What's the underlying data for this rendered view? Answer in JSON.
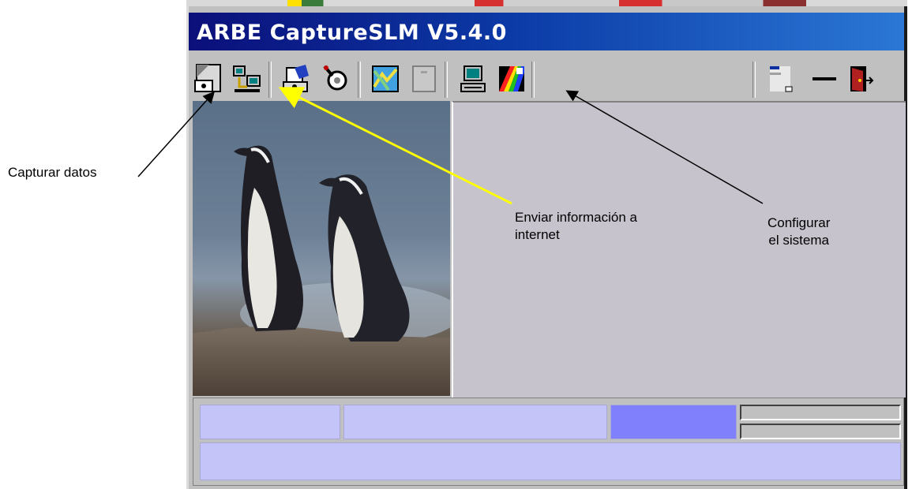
{
  "window": {
    "title": "ARBE CaptureSLM V5.4.0"
  },
  "toolbar": {
    "buttons": [
      {
        "name": "capture-data-icon"
      },
      {
        "name": "send-internet-icon"
      },
      {
        "name": "document-camera-icon"
      },
      {
        "name": "tools-icon"
      },
      {
        "name": "map-icon"
      },
      {
        "name": "blank-page-icon"
      },
      {
        "name": "computer-config-icon"
      },
      {
        "name": "color-palette-icon"
      },
      {
        "name": "restore-window-icon"
      },
      {
        "name": "minimize-icon"
      },
      {
        "name": "exit-door-icon"
      }
    ]
  },
  "annotations": {
    "capture": "Capturar datos",
    "send_line1": "Enviar información a",
    "send_line2": "internet",
    "config_line1": "Configurar",
    "config_line2": "el sistema"
  },
  "colors": {
    "title_start": "#0b0f7a",
    "title_end": "#2b78d6",
    "pane": "#c6c3cc",
    "status_cell": "#c4c4f8",
    "status_highlight": "#8080fc",
    "arrow_yellow": "#ffff00"
  }
}
